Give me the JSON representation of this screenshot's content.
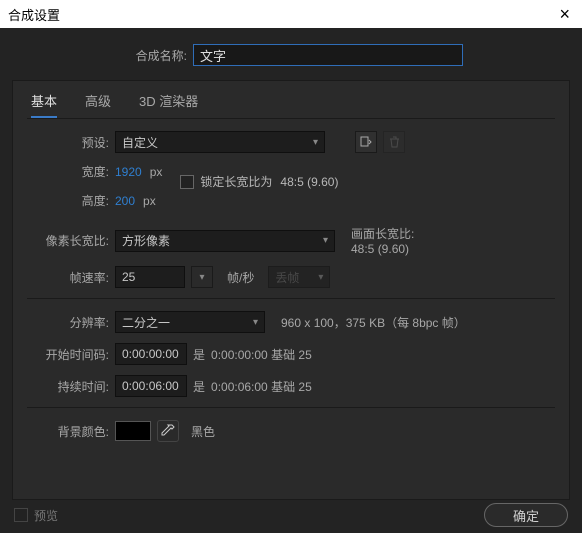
{
  "window": {
    "title": "合成设置"
  },
  "compName": {
    "label": "合成名称:",
    "value": "文字"
  },
  "tabs": {
    "basic": "基本",
    "advanced": "高级",
    "renderer": "3D 渲染器"
  },
  "preset": {
    "label": "预设:",
    "value": "自定义"
  },
  "width": {
    "label": "宽度:",
    "value": "1920",
    "unit": "px"
  },
  "height": {
    "label": "高度:",
    "value": "200",
    "unit": "px"
  },
  "lockAspect": {
    "label": "锁定长宽比为",
    "ratio": "48:5 (9.60)"
  },
  "pixelAspect": {
    "label": "像素长宽比:",
    "value": "方形像素"
  },
  "frameAspect": {
    "label": "画面长宽比:",
    "value": "48:5 (9.60)"
  },
  "frameRate": {
    "label": "帧速率:",
    "value": "25",
    "unit": "帧/秒",
    "dropLabel": "丢帧"
  },
  "resolution": {
    "label": "分辨率:",
    "value": "二分之一",
    "info": "960 x 100，375 KB（每 8bpc 帧）"
  },
  "startTC": {
    "label": "开始时间码:",
    "value": "0:00:00:00",
    "is": "是",
    "base": "0:00:00:00 基础 25"
  },
  "duration": {
    "label": "持续时间:",
    "value": "0:00:06:00",
    "is": "是",
    "base": "0:00:06:00 基础 25"
  },
  "bg": {
    "label": "背景颜色:",
    "name": "黑色",
    "hex": "#000000"
  },
  "footer": {
    "preview": "预览",
    "ok": "确定"
  }
}
